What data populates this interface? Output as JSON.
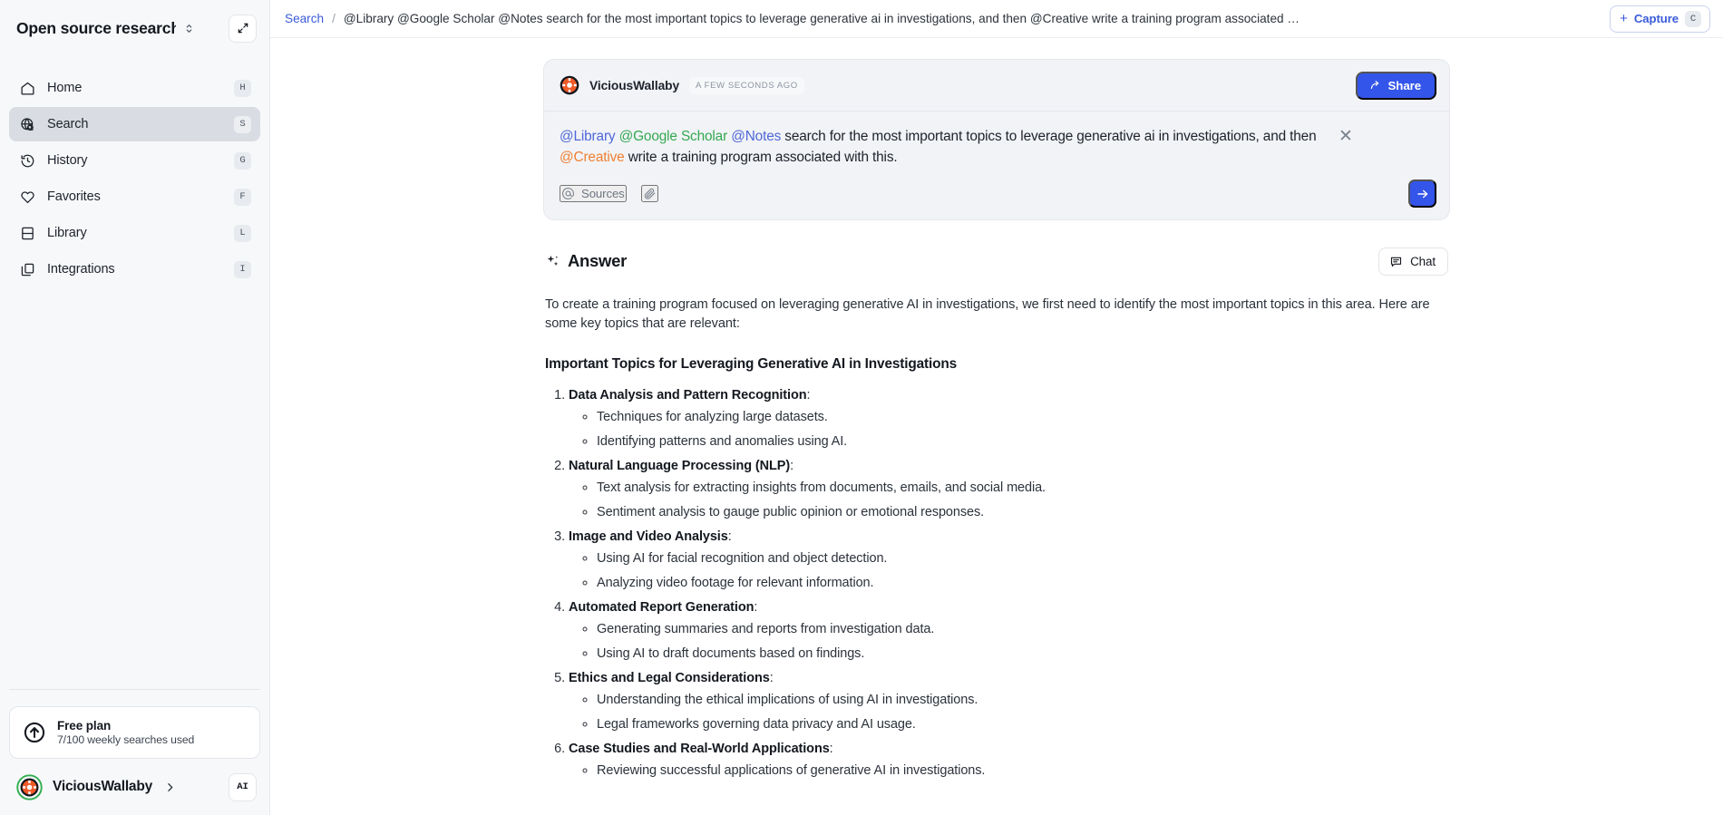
{
  "sidebar": {
    "workspace_title": "Open source research",
    "nav": [
      {
        "label": "Home",
        "key": "H",
        "icon": "home-icon"
      },
      {
        "label": "Search",
        "key": "S",
        "icon": "globe-search-icon"
      },
      {
        "label": "History",
        "key": "G",
        "icon": "clock-history-icon"
      },
      {
        "label": "Favorites",
        "key": "F",
        "icon": "heart-icon"
      },
      {
        "label": "Library",
        "key": "L",
        "icon": "book-icon"
      },
      {
        "label": "Integrations",
        "key": "I",
        "icon": "copy-stack-icon"
      }
    ],
    "plan": {
      "name": "Free plan",
      "usage": "7/100 weekly searches used"
    },
    "user": {
      "name": "ViciousWallaby",
      "badge": "AI"
    }
  },
  "topbar": {
    "breadcrumb_root": "Search",
    "breadcrumb_separator": "/",
    "breadcrumb_current": "@Library @Google Scholar @Notes search for the most important topics to leverage generative ai in investigations, and then @Creative write a training program associated …",
    "capture_label": "Capture",
    "capture_key": "C",
    "capture_plus": "+"
  },
  "query_card": {
    "author": "ViciousWallaby",
    "timestamp": "A FEW SECONDS AGO",
    "share_label": "Share",
    "text_parts": [
      {
        "t": "@Library",
        "c": "blue"
      },
      {
        "t": " ",
        "c": "plain"
      },
      {
        "t": "@Google Scholar",
        "c": "green"
      },
      {
        "t": " ",
        "c": "plain"
      },
      {
        "t": "@Notes",
        "c": "blue"
      },
      {
        "t": " search for the most important topics to leverage generative ai in investigations, and then ",
        "c": "plain"
      },
      {
        "t": "@Creative",
        "c": "orange"
      },
      {
        "t": " write a training program associated with this.",
        "c": "plain"
      }
    ],
    "sources_label": "Sources",
    "close_glyph": "✕"
  },
  "answer": {
    "title": "Answer",
    "chat_label": "Chat",
    "intro": "To create a training program focused on leveraging generative AI in investigations, we first need to identify the most important topics in this area. Here are some key topics that are relevant:",
    "heading": "Important Topics for Leveraging Generative AI in Investigations",
    "topics": [
      {
        "title": "Data Analysis and Pattern Recognition",
        "suffix": ":",
        "bullets": [
          "Techniques for analyzing large datasets.",
          "Identifying patterns and anomalies using AI."
        ]
      },
      {
        "title": "Natural Language Processing (NLP)",
        "suffix": ":",
        "bullets": [
          "Text analysis for extracting insights from documents, emails, and social media.",
          "Sentiment analysis to gauge public opinion or emotional responses."
        ]
      },
      {
        "title": "Image and Video Analysis",
        "suffix": ":",
        "bullets": [
          "Using AI for facial recognition and object detection.",
          "Analyzing video footage for relevant information."
        ]
      },
      {
        "title": "Automated Report Generation",
        "suffix": ":",
        "bullets": [
          "Generating summaries and reports from investigation data.",
          "Using AI to draft documents based on findings."
        ]
      },
      {
        "title": "Ethics and Legal Considerations",
        "suffix": ":",
        "bullets": [
          "Understanding the ethical implications of using AI in investigations.",
          "Legal frameworks governing data privacy and AI usage."
        ]
      },
      {
        "title": "Case Studies and Real-World Applications",
        "suffix": ":",
        "bullets": [
          "Reviewing successful applications of generative AI in investigations."
        ]
      }
    ]
  },
  "colors": {
    "accent_blue": "#3355ea",
    "link_blue": "#3a5bd9",
    "mention_blue": "#4f67d8",
    "mention_green": "#35a852",
    "mention_orange": "#f08033",
    "sidebar_bg": "#f7f8fa",
    "active_nav_bg": "#d9dde3",
    "card_bg": "#f1f3f6"
  }
}
